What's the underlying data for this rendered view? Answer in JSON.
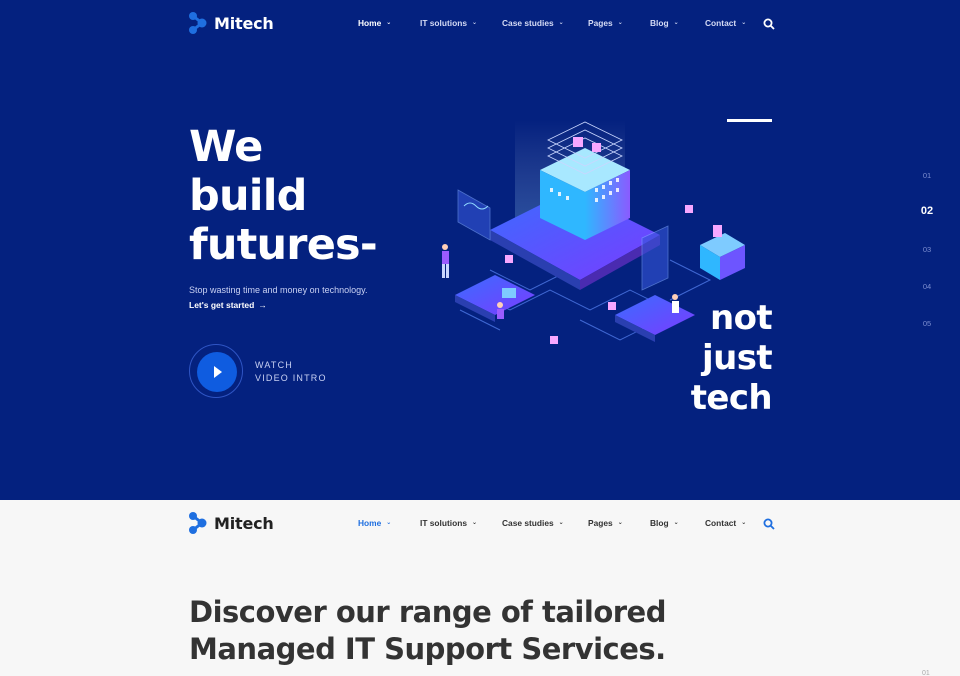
{
  "brand": {
    "name": "Mitech",
    "accent": "#1f6fe0",
    "hero_bg": "#04217f"
  },
  "nav": {
    "items": [
      {
        "label": "Home",
        "active": true
      },
      {
        "label": "IT solutions"
      },
      {
        "label": "Case studies"
      },
      {
        "label": "Pages"
      },
      {
        "label": "Blog"
      },
      {
        "label": "Contact"
      }
    ],
    "chevron": "⌄",
    "search_icon": "search-icon"
  },
  "hero": {
    "headline": [
      "We",
      "build",
      "futures-"
    ],
    "subtitle": "Stop wasting time and money on technology.",
    "cta": "Let's get started",
    "cta_arrow": "→",
    "video": {
      "line1": "WATCH",
      "line2": "VIDEO INTRO"
    },
    "tagline": [
      "not",
      "just",
      "tech"
    ],
    "slides": [
      "01",
      "02",
      "03",
      "04",
      "05"
    ],
    "active_slide": "02"
  },
  "section": {
    "heading_line1": "Discover our range of tailored",
    "heading_line2": "Managed IT Support Services.",
    "corner_number": "01"
  }
}
